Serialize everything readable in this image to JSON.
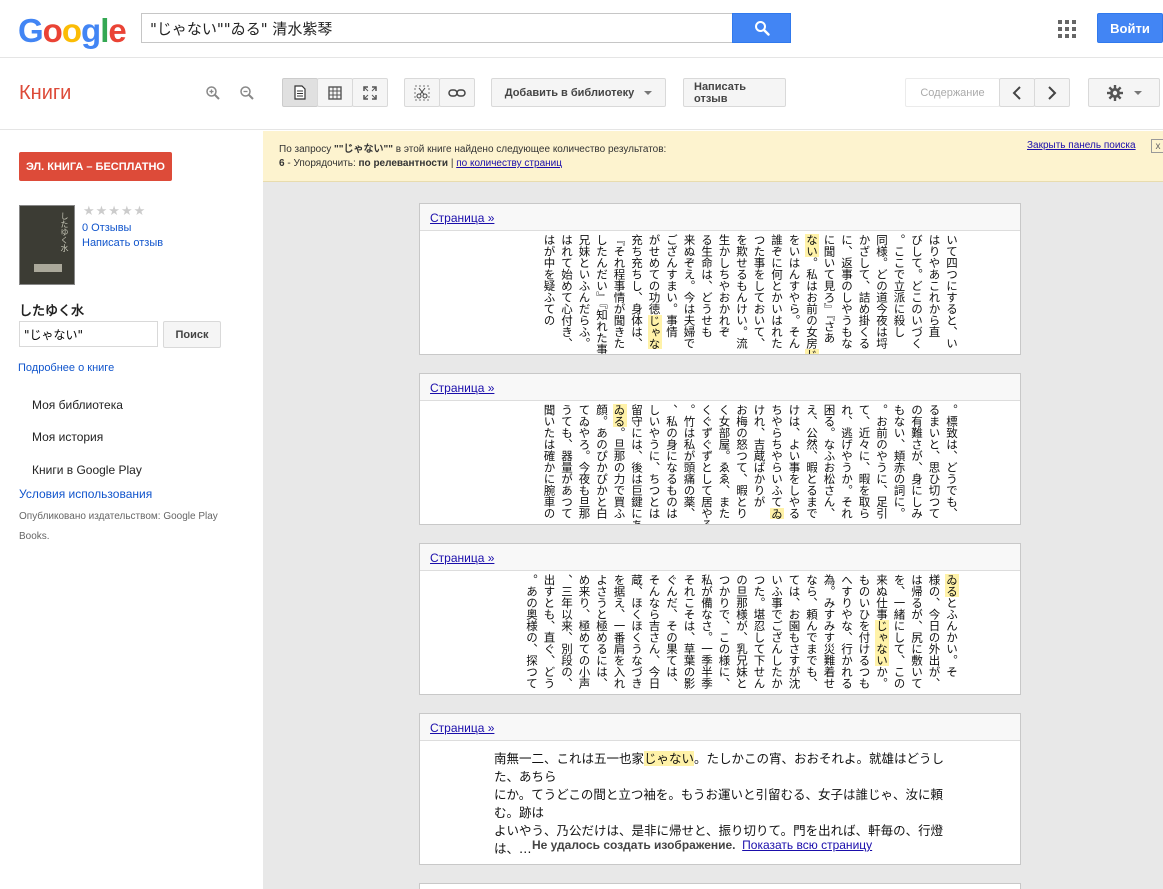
{
  "header": {
    "logo_letters": [
      {
        "ch": "G",
        "color": "#4285f4"
      },
      {
        "ch": "o",
        "color": "#ea4335"
      },
      {
        "ch": "o",
        "color": "#fbbc05"
      },
      {
        "ch": "g",
        "color": "#4285f4"
      },
      {
        "ch": "l",
        "color": "#34a853"
      },
      {
        "ch": "e",
        "color": "#ea4335"
      }
    ],
    "search_value": "\"じゃない\"\"ゐる\" 清水紫琴",
    "search_icon": "search-icon",
    "apps_icon": "apps-grid-icon",
    "login_label": "Войти"
  },
  "toolbar": {
    "section_title": "Книги",
    "add_library_label": "Добавить в библиотеку",
    "write_review_label": "Написать отзыв",
    "contents_label": "Содержание"
  },
  "sidebar": {
    "ebook_label": "ЭЛ. КНИГА – БЕСПЛАТНО",
    "stars": "★★★★★",
    "reviews_label": "0 Отзывы",
    "write_review_label": "Написать отзыв",
    "book_title": "したゆく水",
    "inbook_query": "\"じゃない\"",
    "inbook_search_label": "Поиск",
    "more_about_label": "Подробнее о книге",
    "nav": [
      "Моя библиотека",
      "Моя история",
      "Книги в Google Play"
    ],
    "terms_label": "Условия использования",
    "published_text": "Опубликовано издательством: Google Play Books."
  },
  "notice": {
    "prefix": "По запросу ",
    "query": "\"\"じゃない\"\"",
    "suffix": " в этой книге найдено следующее количество результатов:",
    "count": "6",
    "sort_prefix": " -  Упорядочить: ",
    "sort_relevance": "по релевантности",
    "sort_sep": " | ",
    "sort_pages": "по количеству страниц",
    "close_label": "Закрыть панель поиска",
    "close_x": "x"
  },
  "results": [
    {
      "page_link": "Страница »",
      "columns": [
        "いて四つにすると、い",
        "はりやあこれから直",
        "びして。どこのいづく",
        "。ここで立派に殺し",
        "同様。どの道今夜は埒",
        "かざして、詰め掛くる",
        "に、返事のしやうもな",
        "に聞いて見ろ』『さあ",
        "[[ない]]。私はお前の女房[[じゃ]]",
        "をいはんすやら。そん",
        "誰ぞに何とかいはれた",
        "つた事をしておいて、",
        "を欺せるもんけい。流",
        "生かしちやおかれぞ",
        "る生命は、どうせも",
        "来ぬぞえ。今は夫婦で",
        "ござんすまい。事情",
        "がせめての功徳[[じゃな]]",
        "充ち充ちし、身体は、",
        "『それ程事情が聞きた",
        "したんだい』『知れた事",
        "兄妹といふんだらふ。",
        "はれて始めて心付き、",
        "はが中を疑ふての"
      ]
    },
    {
      "page_link": "Страница »",
      "columns": [
        "。標致は、どうでも、",
        "るまいと、思ひ切つて",
        "の有難さが、身にしみ",
        "もない、頬赤の詞に。",
        "。お前のやうに、足引",
        "て、近々に、暇を取ら",
        "れ、逃げやうか。それ",
        "困る。なふお松さん、",
        "え、公然、暇とるまで",
        "けは、よい事をしやる",
        "ちやらちやらいふて[[ゐ]]",
        "けれ、吉蔵ばかりが",
        "お梅の怒つて、暇とり",
        "く女部屋。ゑゑ、また",
        "くぐずぐずとして居やる",
        "。竹は私が頭痛の薬、",
        "、私の身になるものは",
        "しいやうに、ちつとは",
        "留守には、後は巨鍵にあたる",
        "[[ゐる]]。旦那の力で買ふ",
        "顔。あのぴかぴかと白",
        "てゐやろ。今夜も旦那",
        "うても、器量があつて",
        "聞いたは確かに腕車の"
      ]
    },
    {
      "page_link": "Страница »",
      "columns": [
        "[[ゐる]]とふんかい。そ",
        "様の、今日の外出が、",
        "は帰るが、尻に敷いて",
        "を、一緒にして、この",
        "来ぬ仕事[[じゃない]]か。",
        "ものいひを付けるつも",
        "へすりやな、行かれる",
        "為。みすみす災難着せ",
        "なら、頼んでまでも、",
        "ては、お園もさすが沈",
        "いふ事でござんしたか",
        "つた。堪忍して下せん",
        "の旦那様が、乳兄妹と",
        "つかりで、この様に、",
        "私が備なさ。一季半季",
        "それこそは、草葉の影",
        "ぐんだ、その果ては、",
        "そんなら吉さん、今日",
        "蔵、ほくほくうなづき",
        "を据え、一番肩を入れ",
        "よさうと極めるには、",
        "め来り、極めての小声",
        "、三年以来、別段の、",
        "出すとも、直ぐ、どう",
        "。あの奥様の、探つて"
      ]
    },
    {
      "page_link": "Страница »",
      "text_lines": [
        "南無一二、これは五一也家[[じゃない]]。たしかこの宵、おおそれよ。就雄はどうした、あちら",
        "にか。てうどこの間と立つ袖を。もうお運いと引留むる、女子は誰じゃ、汝に頼む。跡は",
        "よいやう、乃公だけは、是非に帰せと、振り切りて。門を出れば、軒毎の、行燈は、…"
      ],
      "fail_msg": "Не удалось создать изображение.",
      "show_page_link": "Показать всю страницу"
    }
  ],
  "colors": {
    "accent_red": "#dd4b39",
    "google_blue": "#4285f4",
    "highlight": "#fff2a8",
    "notice_bg": "#fdf3cf"
  }
}
